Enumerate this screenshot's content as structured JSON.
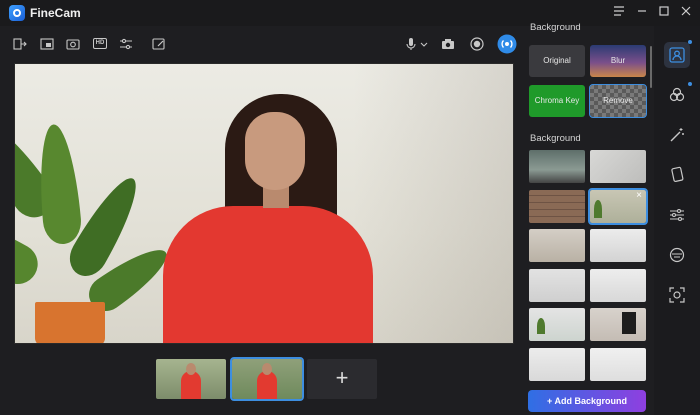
{
  "app": {
    "title": "FineCam"
  },
  "window_controls": [
    "menu-icon",
    "minimize-icon",
    "maximize-icon",
    "close-icon"
  ],
  "toolbar": {
    "left_icons": [
      "exit-icon",
      "picture-in-picture-icon",
      "rotate-camera-icon",
      "hd-icon",
      "adjust-icon",
      "edit-icon"
    ],
    "hd_label": "HD",
    "right_icons": [
      "microphone-icon",
      "chevron-down-icon",
      "snapshot-icon",
      "record-icon",
      "live-broadcast-icon"
    ]
  },
  "cameras": {
    "items": [
      {
        "name": "camera-1",
        "selected": false
      },
      {
        "name": "camera-2",
        "selected": true
      }
    ],
    "add_label": "+"
  },
  "panel": {
    "top_section_label": "Background",
    "modes": [
      {
        "label": "Original",
        "color": "#3a3a3e"
      },
      {
        "label": "Blur",
        "color": "#5a3a6e"
      },
      {
        "label": "Chroma Key",
        "color": "#1f9a2a"
      },
      {
        "label": "Remove",
        "color": "#6b6b6b"
      }
    ],
    "gallery_label": "Background",
    "gallery": [
      {
        "theme": "office-desk",
        "color": "#7a8a7a"
      },
      {
        "theme": "white-texture",
        "color": "#cfcfcf"
      },
      {
        "theme": "brick-wall",
        "color": "#8a6a55"
      },
      {
        "theme": "plant-wall",
        "color": "#b9b6a2",
        "selected": true,
        "close_glyph": "×"
      },
      {
        "theme": "living-room",
        "color": "#c9c3ba"
      },
      {
        "theme": "white-room",
        "color": "#e2e2e2"
      },
      {
        "theme": "lamp-room",
        "color": "#d9d9d9"
      },
      {
        "theme": "table-room",
        "color": "#e6e6e6"
      },
      {
        "theme": "plant-corner",
        "color": "#dcdcdc"
      },
      {
        "theme": "doorway",
        "color": "#cfcac4"
      },
      {
        "theme": "dining-room",
        "color": "#e4e4e4"
      },
      {
        "theme": "chair-room",
        "color": "#ebebeb"
      }
    ],
    "add_button": "+ Add Background"
  },
  "rail": {
    "icons": [
      "person-background-icon",
      "effects-icon",
      "magic-wand-icon",
      "screen-icon",
      "sliders-icon",
      "avatar-icon",
      "face-frame-icon"
    ]
  }
}
